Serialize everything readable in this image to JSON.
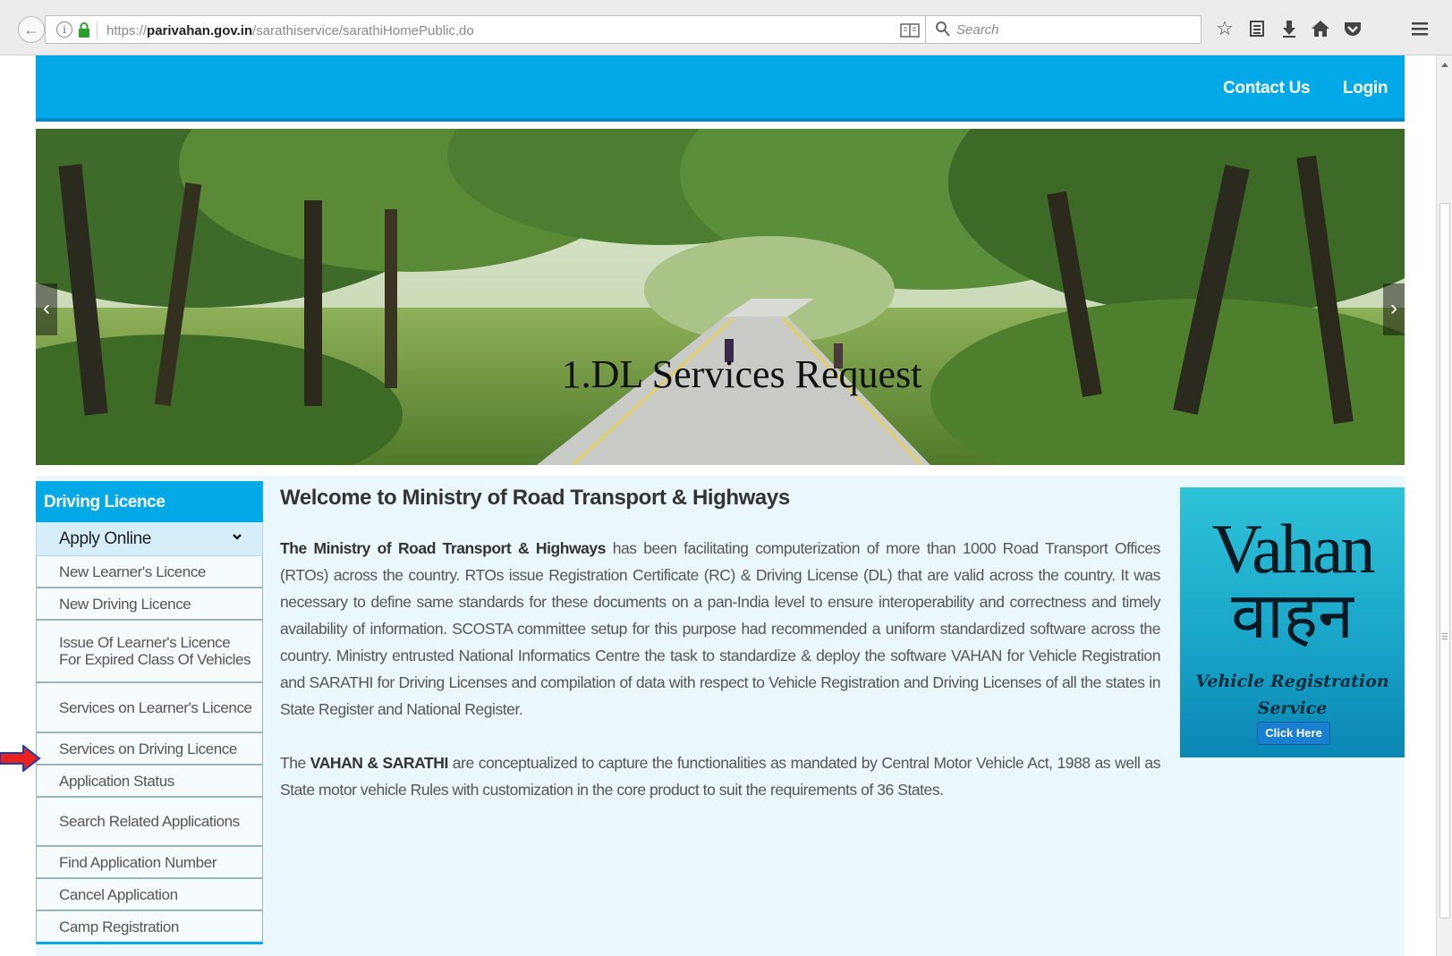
{
  "browser": {
    "url_host": "parivahan.gov.in",
    "url_prefix": "https://",
    "url_path": "/sarathiservice/sarathiHomePublic.do",
    "search_placeholder": "Search"
  },
  "header": {
    "contact": "Contact Us",
    "login": "Login"
  },
  "hero": {
    "caption": "1.DL Services Request",
    "prev": "‹",
    "next": "›"
  },
  "sidebar": {
    "title": "Driving Licence",
    "apply_label": "Apply Online",
    "items": [
      {
        "label": "New Learner's Licence"
      },
      {
        "label": "New Driving Licence"
      },
      {
        "label": "Issue Of Learner's Licence For Expired Class Of Vehicles"
      },
      {
        "label": "Services on Learner's Licence"
      },
      {
        "label": "Services on Driving Licence"
      },
      {
        "label": "Application Status"
      },
      {
        "label": "Search Related Applications"
      },
      {
        "label": "Find Application Number"
      },
      {
        "label": "Cancel Application"
      },
      {
        "label": "Camp Registration"
      }
    ]
  },
  "main": {
    "heading": "Welcome to Ministry of Road Transport & Highways",
    "p1_bold": "The Ministry of Road Transport & Highways",
    "p1_text": " has been facilitating computerization of more than 1000 Road Transport Offices (RTOs) across the country. RTOs issue Registration Certificate (RC) & Driving License (DL) that are valid across the country. It was necessary to define same standards for these documents on a pan-India level to ensure interoperability and correctness and timely availability of information. SCOSTA committee setup for this purpose had recommended a uniform standardized software across the country. Ministry entrusted National Informatics Centre the task to standardize & deploy the software VAHAN for Vehicle Registration and SARATHI for Driving Licenses and compilation of data with respect to Vehicle Registration and Driving Licenses of all the states in State Register and National Register.",
    "p2_pre": "The ",
    "p2_bold": "VAHAN & SARATHI",
    "p2_text": " are conceptualized to capture the functionalities as mandated by Central Motor Vehicle Act, 1988 as well as State motor vehicle Rules with customization in the core product to suit the requirements of 36 States."
  },
  "vahan": {
    "logo": "Vahan",
    "logo_hindi": "वाहन",
    "subtitle_line1": "Vehicle Registration",
    "subtitle_line2": "Service",
    "button": "Click Here"
  },
  "colors": {
    "brand_blue": "#03a9e6",
    "content_bg": "#eaf7fc",
    "arrow_red": "#e8231f",
    "arrow_border": "#1e3fa8"
  }
}
